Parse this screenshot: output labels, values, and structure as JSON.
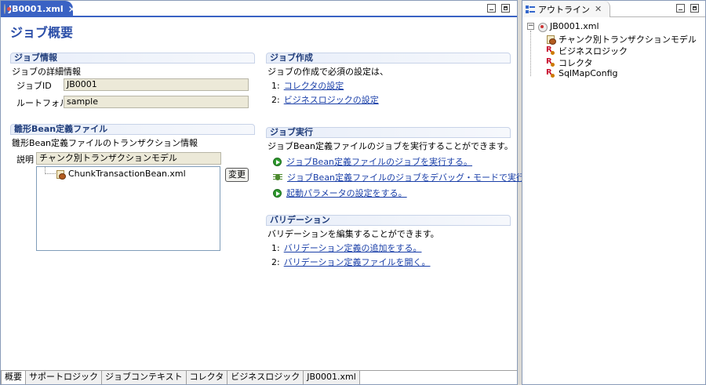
{
  "editor": {
    "tab_title": "JB0001.xml",
    "page_title": "ジョブ概要",
    "job_info": {
      "header": "ジョブ情報",
      "desc": "ジョブの詳細情報",
      "job_id_label": "ジョブID",
      "job_id_value": "JB0001",
      "root_folder_label": "ルートフォルダ",
      "root_folder_value": "sample"
    },
    "bean_file": {
      "header": "雛形Bean定義ファイル",
      "desc": "雛形Bean定義ファイルのトランザクション情報",
      "desc_label": "説明",
      "desc_value": "チャンク別トランザクションモデル",
      "tree_item": "ChunkTransactionBean.xml",
      "change_button": "変更"
    },
    "job_create": {
      "header": "ジョブ作成",
      "desc": "ジョブの作成で必須の設定は、",
      "items": [
        {
          "num": "1:",
          "link": "コレクタの設定"
        },
        {
          "num": "2:",
          "link": "ビジネスロジックの設定"
        }
      ]
    },
    "job_run": {
      "header": "ジョブ実行",
      "desc": "ジョブBean定義ファイルのジョブを実行することができます。",
      "items": [
        {
          "icon": "run-icon",
          "link": "ジョブBean定義ファイルのジョブを実行する。"
        },
        {
          "icon": "debug-icon",
          "link": "ジョブBean定義ファイルのジョブをデバッグ・モードで実行する。"
        },
        {
          "icon": "run-icon",
          "link": "起動パラメータの設定をする。"
        }
      ]
    },
    "validation": {
      "header": "バリデーション",
      "desc": "バリデーションを編集することができます。",
      "items": [
        {
          "num": "1:",
          "link": "バリデーション定義の追加をする。"
        },
        {
          "num": "2:",
          "link": "バリデーション定義ファイルを開く。"
        }
      ]
    },
    "bottom_tabs": [
      "概要",
      "サポートロジック",
      "ジョブコンテキスト",
      "コレクタ",
      "ビジネスロジック",
      "JB0001.xml"
    ]
  },
  "outline": {
    "tab_title": "アウトライン",
    "root": "JB0001.xml",
    "children": [
      "チャンク別トランザクションモデル",
      "ビジネスロジック",
      "コレクタ",
      "SqlMapConfig"
    ]
  },
  "colors": {
    "active_tab": "#3a62c4",
    "link": "#1a3fa8",
    "section_title": "#1f3c7a"
  }
}
